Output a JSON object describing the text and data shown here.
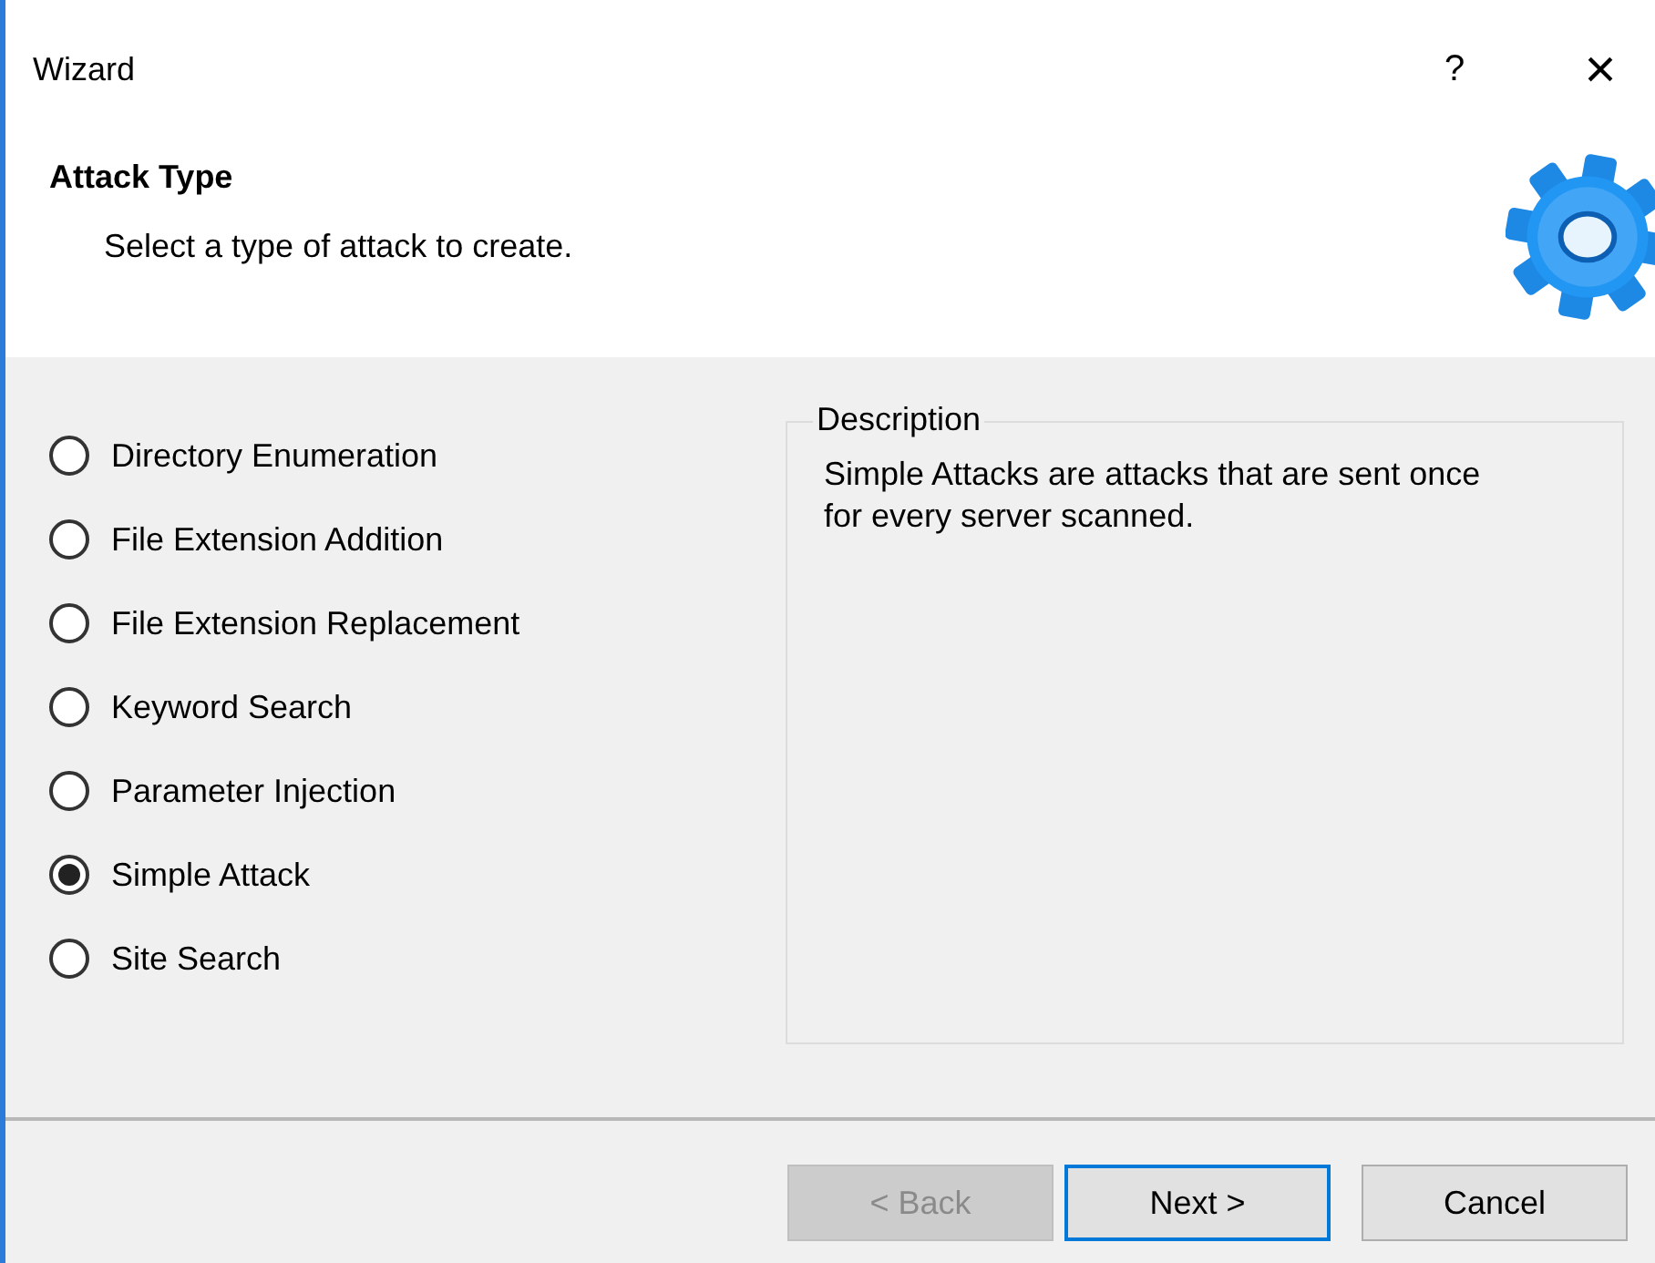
{
  "window": {
    "title": "Wizard",
    "help_glyph": "?",
    "close_glyph": "×"
  },
  "header": {
    "title": "Attack Type",
    "subtitle": "Select a type of attack to create."
  },
  "options": [
    {
      "label": "Directory Enumeration",
      "selected": false
    },
    {
      "label": "File Extension Addition",
      "selected": false
    },
    {
      "label": "File Extension Replacement",
      "selected": false
    },
    {
      "label": "Keyword Search",
      "selected": false
    },
    {
      "label": "Parameter Injection",
      "selected": false
    },
    {
      "label": "Simple Attack",
      "selected": true
    },
    {
      "label": "Site Search",
      "selected": false
    }
  ],
  "description": {
    "legend": "Description",
    "text": "Simple Attacks are attacks that are sent once for every server scanned."
  },
  "buttons": [
    {
      "label": "< Back",
      "disabled": true,
      "default": false
    },
    {
      "label": "Next >",
      "disabled": false,
      "default": true
    },
    {
      "label": "Cancel",
      "disabled": false,
      "default": false
    }
  ]
}
